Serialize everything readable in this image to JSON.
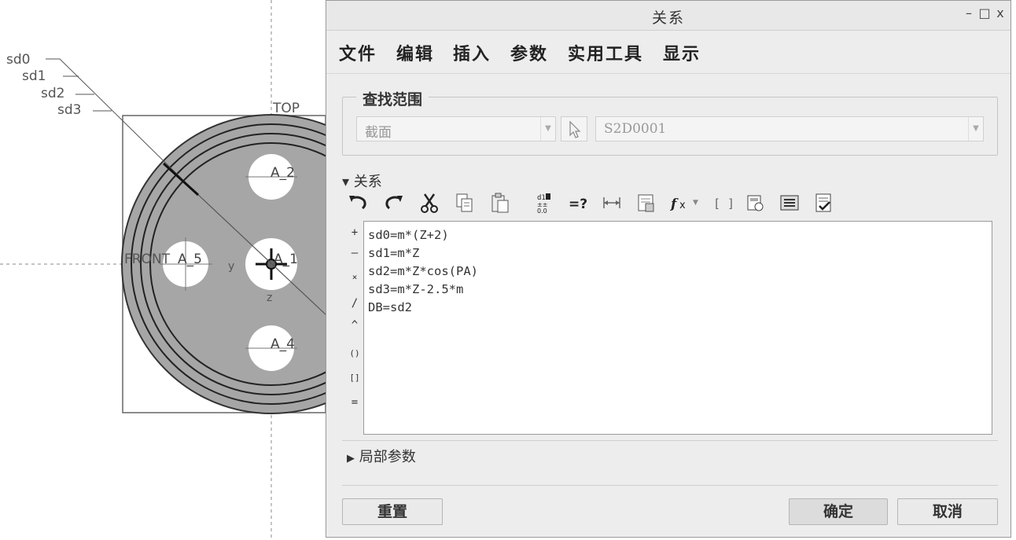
{
  "cad": {
    "dims": [
      "sd0",
      "sd1",
      "sd2",
      "sd3"
    ],
    "planes": {
      "top": "TOP",
      "front": "FRONT"
    },
    "axes": [
      "A_2",
      "A_5",
      "A_1",
      "A_4"
    ],
    "axis_y": "y",
    "axis_z": "z"
  },
  "dialog": {
    "title": "关系",
    "window_buttons": {
      "minimize": "–",
      "maximize": "□",
      "close": "x"
    },
    "menu": [
      "文件",
      "编辑",
      "插入",
      "参数",
      "实用工具",
      "显示"
    ],
    "search": {
      "legend": "查找范围",
      "scope_value": "截面",
      "object_value": "S2D0001"
    },
    "relations_header": "关系",
    "operators": [
      "+",
      "–",
      "×",
      "/",
      "^",
      "()",
      "[]",
      "="
    ],
    "relations": [
      "sd0=m*(Z+2)",
      "sd1=m*Z",
      "sd2=m*Z*cos(PA)",
      "sd3=m*Z-2.5*m",
      "DB=sd2"
    ],
    "local_params": "局部参数",
    "buttons": {
      "reset": "重置",
      "ok": "确定",
      "cancel": "取消"
    }
  }
}
